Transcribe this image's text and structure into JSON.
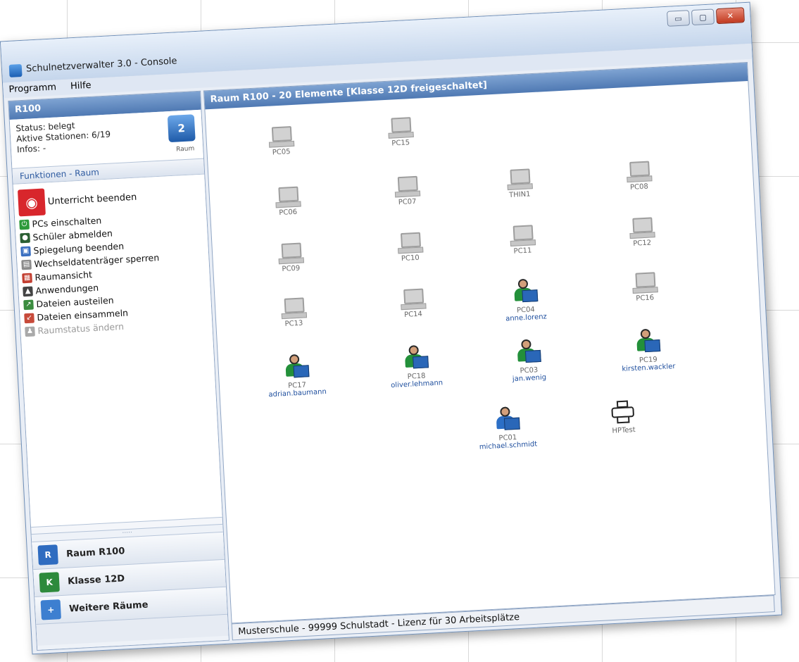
{
  "window": {
    "title": "Schulnetzverwalter 3.0 - Console",
    "buttons": {
      "minimize": "▭",
      "maximize": "▢",
      "close": "✕"
    }
  },
  "menu": [
    "Programm",
    "Hilfe"
  ],
  "left": {
    "header": "R100",
    "info": {
      "status": "Status: belegt",
      "active": "Aktive Stationen: 6/19",
      "infos": "Infos: -",
      "icon_label": "Raum"
    },
    "functions_header": "Funktionen - Raum",
    "functions": [
      {
        "label": "Unterricht beenden",
        "icon": "stop-lesson-icon",
        "color": "#d8262c",
        "enabled": true
      },
      {
        "label": "PCs einschalten",
        "icon": "power-on-icon",
        "color": "#2d9a3a",
        "enabled": true
      },
      {
        "label": "Schüler abmelden",
        "icon": "logout-user-icon",
        "color": "#2a5f32",
        "enabled": true
      },
      {
        "label": "Spiegelung beenden",
        "icon": "mirror-stop-icon",
        "color": "#3a6fc0",
        "enabled": true
      },
      {
        "label": "Wechseldatenträger sperren",
        "icon": "usb-lock-icon",
        "color": "#8c8c8c",
        "enabled": true
      },
      {
        "label": "Raumansicht",
        "icon": "room-view-icon",
        "color": "#c23d2f",
        "enabled": true
      },
      {
        "label": "Anwendungen",
        "icon": "applications-icon",
        "color": "#444444",
        "enabled": true
      },
      {
        "label": "Dateien austeilen",
        "icon": "distribute-files-icon",
        "color": "#3b8c3f",
        "enabled": true
      },
      {
        "label": "Dateien einsammeln",
        "icon": "collect-files-icon",
        "color": "#c74a3a",
        "enabled": true
      },
      {
        "label": "Raumstatus ändern",
        "icon": "room-status-icon",
        "color": "#a9a9a9",
        "enabled": false
      }
    ],
    "nav": [
      {
        "label": "Raum R100",
        "icon": "room-icon",
        "color": "#2f6cc0"
      },
      {
        "label": "Klasse 12D",
        "icon": "class-icon",
        "color": "#2d8a3c"
      },
      {
        "label": "Weitere Räume",
        "icon": "more-rooms-icon",
        "color": "#3d7fd0"
      }
    ]
  },
  "right": {
    "header": "Raum R100 - 20 Elemente [Klasse 12D freigeschaltet]",
    "stations": [
      {
        "name": "PC05",
        "type": "pc",
        "user": ""
      },
      {
        "name": "PC15",
        "type": "pc",
        "user": ""
      },
      {
        "name": "PC06",
        "type": "pc",
        "user": ""
      },
      {
        "name": "PC07",
        "type": "pc",
        "user": ""
      },
      {
        "name": "THIN1",
        "type": "pc",
        "user": ""
      },
      {
        "name": "PC08",
        "type": "pc",
        "user": ""
      },
      {
        "name": "PC09",
        "type": "pc",
        "user": ""
      },
      {
        "name": "PC10",
        "type": "pc",
        "user": ""
      },
      {
        "name": "PC11",
        "type": "pc",
        "user": ""
      },
      {
        "name": "PC12",
        "type": "pc",
        "user": ""
      },
      {
        "name": "PC13",
        "type": "pc",
        "user": ""
      },
      {
        "name": "PC14",
        "type": "pc",
        "user": ""
      },
      {
        "name": "PC04",
        "type": "user",
        "user": "anne.lorenz"
      },
      {
        "name": "PC16",
        "type": "pc",
        "user": ""
      },
      {
        "name": "PC17",
        "type": "user",
        "user": "adrian.baumann"
      },
      {
        "name": "PC18",
        "type": "user",
        "user": "oliver.lehmann"
      },
      {
        "name": "PC03",
        "type": "user",
        "user": "jan.wenig"
      },
      {
        "name": "PC19",
        "type": "user",
        "user": "kirsten.wackler"
      },
      {
        "name": "PC01",
        "type": "user",
        "user": "michael.schmidt"
      },
      {
        "name": "HPTest",
        "type": "printer",
        "user": ""
      }
    ]
  },
  "statusbar": "Musterschule - 99999 Schulstadt - Lizenz für 30 Arbeitsplätze"
}
